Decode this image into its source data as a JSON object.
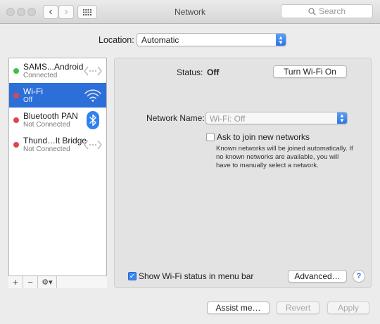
{
  "window": {
    "title": "Network",
    "search_placeholder": "Search",
    "nav_back": "‹",
    "nav_forward": "›",
    "grid_icon": "show-all-grid-icon"
  },
  "location": {
    "label": "Location:",
    "value": "Automatic"
  },
  "services": [
    {
      "name": "SAMS...Android",
      "status": "Connected",
      "dot": "#3fbf4a",
      "icon": "thunderbolt-arrows-icon"
    },
    {
      "name": "Wi-Fi",
      "status": "Off",
      "dot": "#e0454d",
      "icon": "wifi-icon",
      "selected": true
    },
    {
      "name": "Bluetooth PAN",
      "status": "Not Connected",
      "dot": "#e0454d",
      "icon": "bluetooth-icon"
    },
    {
      "name": "Thund…lt Bridge",
      "status": "Not Connected",
      "dot": "#e0454d",
      "icon": "thunderbolt-arrows-icon"
    }
  ],
  "sidebar_toolbar": {
    "add": "+",
    "remove": "−",
    "action": "⚙▾"
  },
  "detail": {
    "status_label": "Status:",
    "status_value": "Off",
    "turn_on_button": "Turn Wi-Fi On",
    "network_name_label": "Network Name:",
    "network_name_value": "Wi-Fi: Off",
    "ask_join_label": "Ask to join new networks",
    "ask_join_checked": false,
    "ask_join_help": "Known networks will be joined automatically. If no known networks are available, you will have to manually select a network.",
    "show_status_label": "Show Wi-Fi status in menu bar",
    "show_status_checked": true,
    "advanced_button": "Advanced…",
    "help_button": "?"
  },
  "footer": {
    "assist_button": "Assist me…",
    "revert_button": "Revert",
    "apply_button": "Apply"
  },
  "colors": {
    "accent": "#2d6fd8",
    "connected": "#3fbf4a",
    "disconnected": "#e0454d"
  }
}
